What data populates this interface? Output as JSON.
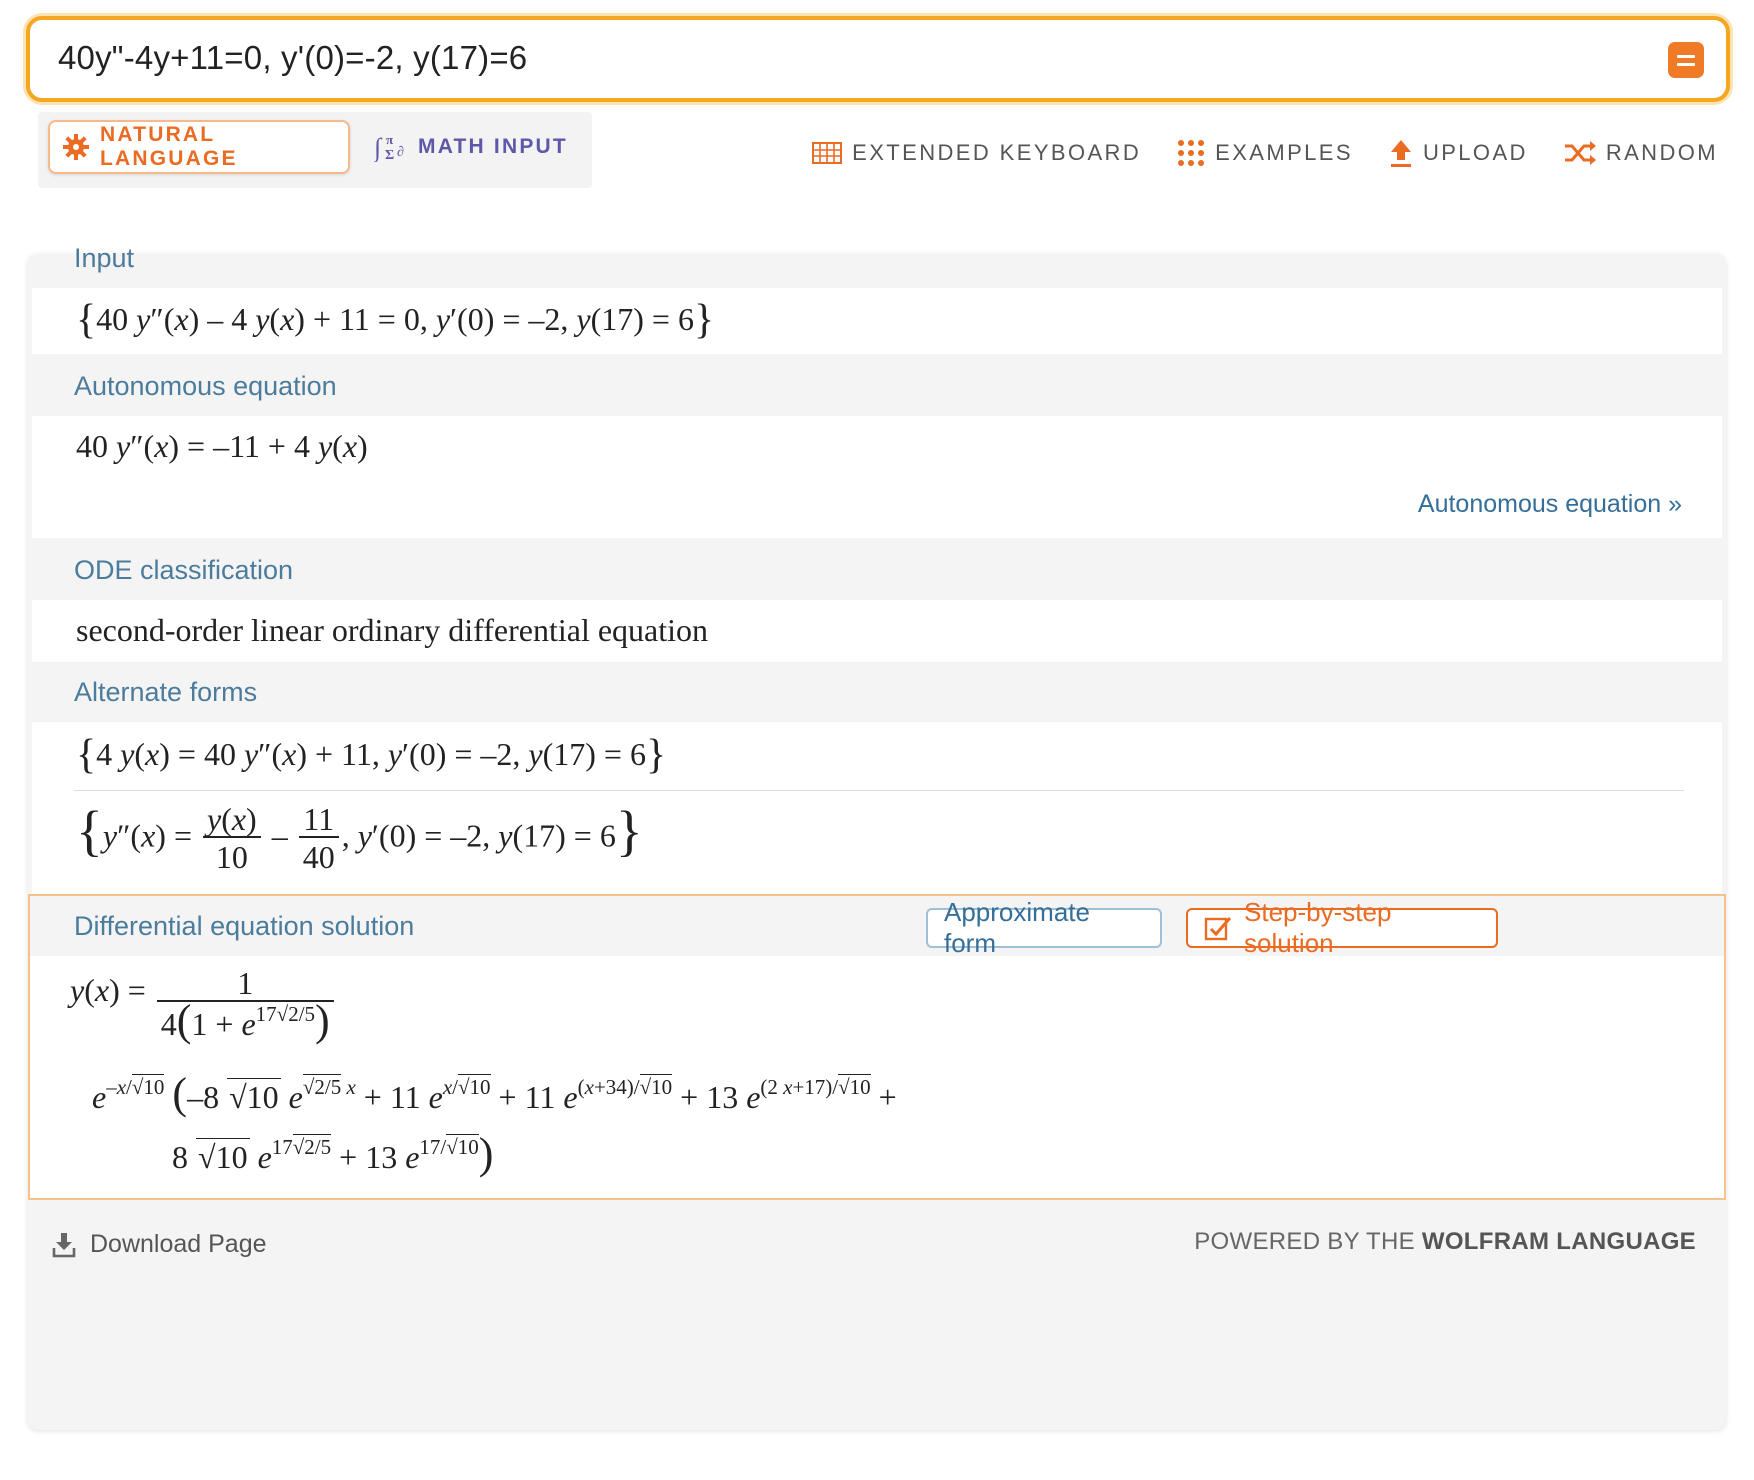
{
  "search": {
    "query": "40y\"-4y+11=0, y'(0)=-2, y(17)=6"
  },
  "modes": {
    "natural_language": "NATURAL LANGUAGE",
    "math_input": "MATH INPUT"
  },
  "tools": {
    "extended_keyboard": "EXTENDED KEYBOARD",
    "examples": "EXAMPLES",
    "upload": "UPLOAD",
    "random": "RANDOM"
  },
  "pods": {
    "input": {
      "title": "Input"
    },
    "autonomous": {
      "title": "Autonomous equation",
      "more_link": "Autonomous equation »"
    },
    "ode": {
      "title": "ODE classification",
      "text": "second-order linear ordinary differential equation"
    },
    "alternate": {
      "title": "Alternate forms"
    },
    "solution": {
      "title": "Differential equation solution",
      "approx_button": "Approximate form",
      "step_button": "Step-by-step solution"
    }
  },
  "footer": {
    "download": "Download Page",
    "powered_prefix": "POWERED BY THE ",
    "powered_brand": "WOLFRAM LANGUAGE"
  },
  "colors": {
    "accent": "#ea6b22",
    "search_border": "#f5a623",
    "pod_title": "#4c7c9c",
    "link": "#356f99"
  },
  "icons": {
    "natural_language": "sun-gear-icon",
    "math_input": "math-symbols-icon",
    "extended_keyboard": "keyboard-grid-icon",
    "examples": "dots-grid-icon",
    "upload": "upload-arrow-icon",
    "random": "shuffle-icon",
    "download": "download-icon",
    "step": "checkbox-pencil-icon"
  }
}
